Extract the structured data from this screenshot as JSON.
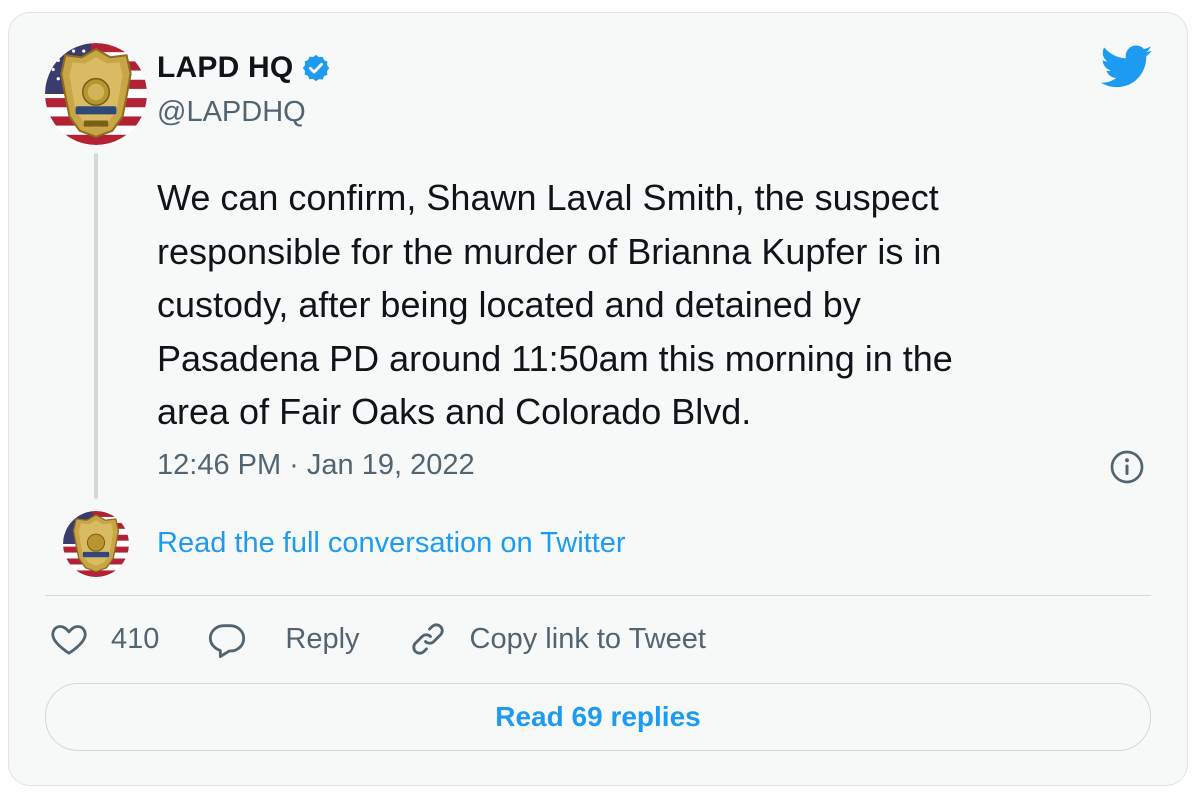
{
  "author": {
    "name": "LAPD HQ",
    "handle": "@LAPDHQ",
    "verified": true,
    "avatar": "police-badge-avatar"
  },
  "tweet": {
    "text": "We can confirm, Shawn Laval Smith, the suspect\nresponsible for the murder of Brianna Kupfer is in\ncustody, after being located and detained by\nPasadena PD around 11:50am this morning in the\narea of Fair Oaks and Colorado Blvd.",
    "timestamp": "12:46 PM · Jan 19, 2022"
  },
  "conversation_link": "Read the full conversation on Twitter",
  "actions": {
    "like_count": "410",
    "reply_label": "Reply",
    "copy_label": "Copy link to Tweet"
  },
  "read_replies_label": "Read 69 replies",
  "icons": {
    "brand": "twitter-bird-icon",
    "verified": "verified-badge-icon",
    "info": "info-icon",
    "like": "heart-icon",
    "reply": "speech-bubble-icon",
    "copy": "link-icon"
  },
  "colors": {
    "accent": "#1d9bf0",
    "text": "#0f1419",
    "muted": "#536471",
    "background": "#f7f9f9"
  }
}
